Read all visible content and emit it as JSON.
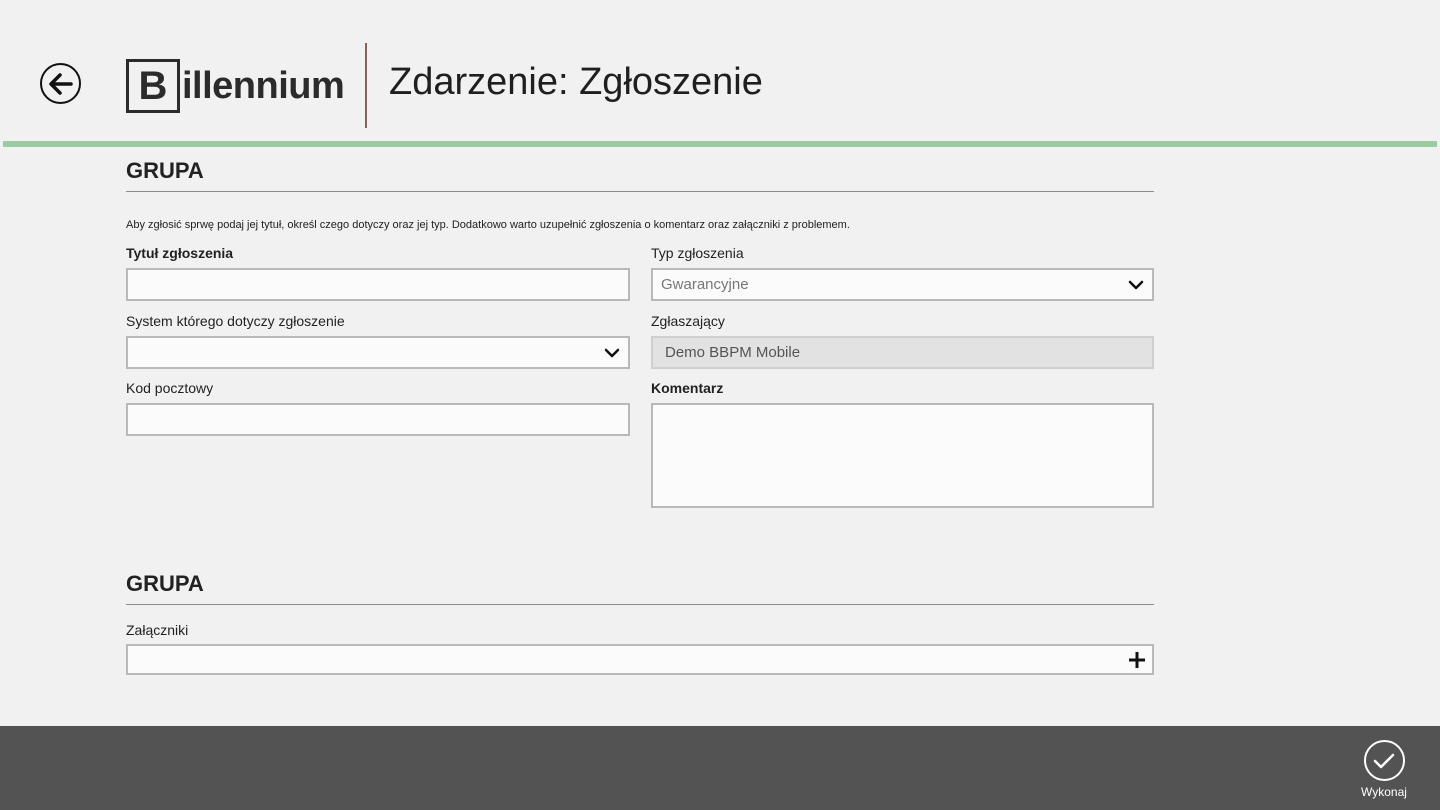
{
  "header": {
    "logo_letter": "B",
    "logo_text": "illennium",
    "title": "Zdarzenie: Zgłoszenie"
  },
  "colors": {
    "accent": "#99cca2",
    "app_bar": "#535353",
    "divider": "#8a5e59"
  },
  "section1": {
    "title": "GRUPA",
    "description": "Aby zgłosić sprwę podaj jej tytuł, określ czego dotyczy oraz jej typ. Dodatkowo warto uzupełnić zgłoszenia o komentarz oraz załączniki z problemem.",
    "fields": {
      "title_label": "Tytuł zgłoszenia",
      "title_value": "",
      "type_label": "Typ zgłoszenia",
      "type_value": "Gwarancyjne",
      "system_label": "System którego dotyczy zgłoszenie",
      "system_value": "",
      "reporter_label": "Zgłaszający",
      "reporter_value": "Demo BBPM Mobile",
      "postal_label": "Kod pocztowy",
      "postal_value": "",
      "comment_label": "Komentarz",
      "comment_value": ""
    }
  },
  "section2": {
    "title": "GRUPA",
    "attachments_label": "Załączniki"
  },
  "app_bar": {
    "execute_label": "Wykonaj"
  },
  "icons": {
    "back": "back-arrow-icon",
    "chevron": "chevron-down-icon",
    "add": "plus-icon",
    "execute": "checkmark-icon"
  }
}
